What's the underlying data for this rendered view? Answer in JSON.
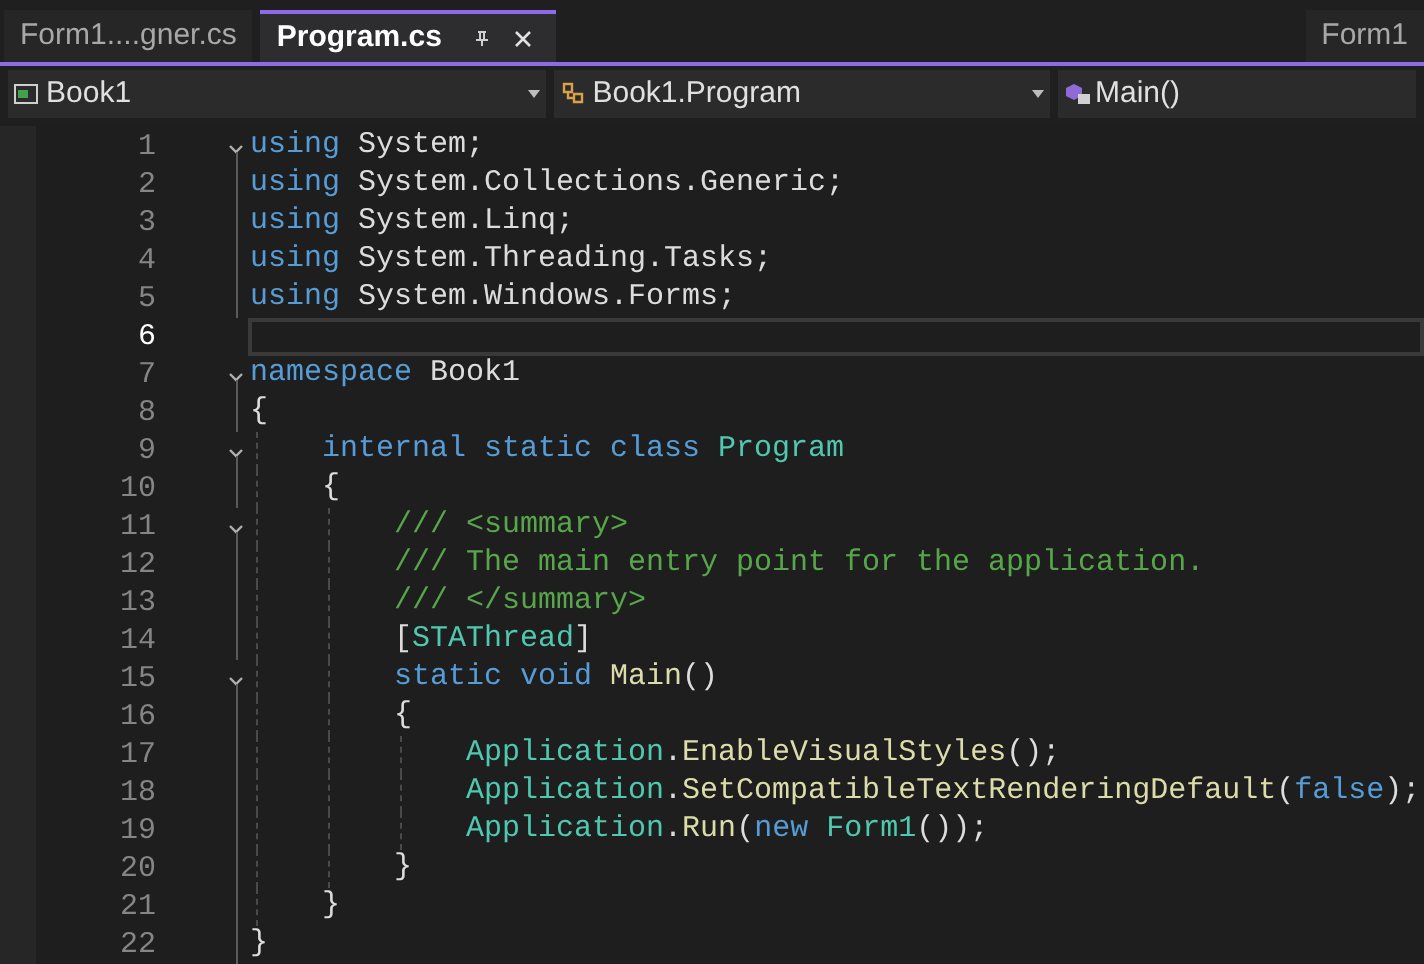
{
  "tabs": [
    {
      "label": "Form1....gner.cs",
      "selected": false,
      "pinned": false
    },
    {
      "label": "Program.cs",
      "selected": true,
      "pinned": true
    },
    {
      "label": "Form1",
      "selected": false,
      "pinned": false
    }
  ],
  "navigation": [
    {
      "label": "Book1",
      "kind": "project"
    },
    {
      "label": "Book1.Program",
      "kind": "class"
    },
    {
      "label": "Main()",
      "kind": "method"
    }
  ],
  "lines": [
    {
      "number": "1",
      "expanded": true,
      "current": false,
      "tokens": [
        {
          "text": "using ",
          "kind": "keyword"
        },
        {
          "text": "System;",
          "kind": "plain"
        }
      ]
    },
    {
      "number": "2",
      "current": false,
      "tokens": [
        {
          "text": "using ",
          "kind": "keyword"
        },
        {
          "text": "System.Collections.Generic;",
          "kind": "plain"
        }
      ]
    },
    {
      "number": "3",
      "current": false,
      "tokens": [
        {
          "text": "using ",
          "kind": "keyword"
        },
        {
          "text": "System.Linq;",
          "kind": "plain"
        }
      ]
    },
    {
      "number": "4",
      "current": false,
      "tokens": [
        {
          "text": "using ",
          "kind": "keyword"
        },
        {
          "text": "System.Threading.Tasks;",
          "kind": "plain"
        }
      ]
    },
    {
      "number": "5",
      "current": false,
      "tokens": [
        {
          "text": "using ",
          "kind": "keyword"
        },
        {
          "text": "System.Windows.Forms;",
          "kind": "plain"
        }
      ]
    },
    {
      "number": "6",
      "current": true
    },
    {
      "number": "7",
      "expanded": true,
      "current": false,
      "tokens": [
        {
          "text": "namespace ",
          "kind": "keyword"
        },
        {
          "text": "Book1",
          "kind": "plain"
        }
      ]
    },
    {
      "number": "8",
      "current": false,
      "tokens": [
        {
          "text": "{",
          "kind": "plain"
        }
      ],
      "children": [
        {
          "number": "9",
          "expanded": true,
          "current": false,
          "tokens": [
            {
              "text": "internal static class ",
              "kind": "keyword"
            },
            {
              "text": "Program",
              "kind": "type"
            }
          ]
        },
        {
          "number": "10",
          "current": false,
          "tokens": [
            {
              "text": "{",
              "kind": "plain"
            }
          ],
          "children": [
            {
              "number": "11",
              "expanded": true,
              "current": false,
              "tokens": [
                {
                  "text": "/// <summary>",
                  "kind": "comment"
                }
              ]
            },
            {
              "number": "12",
              "current": false,
              "tokens": [
                {
                  "text": "/// The main entry point for the application.",
                  "kind": "comment"
                }
              ]
            },
            {
              "number": "13",
              "current": false,
              "tokens": [
                {
                  "text": "/// </summary>",
                  "kind": "comment"
                }
              ]
            },
            {
              "number": "14",
              "current": false,
              "tokens": [
                {
                  "text": "[",
                  "kind": "plain"
                },
                {
                  "text": "STAThread",
                  "kind": "type"
                },
                {
                  "text": "]",
                  "kind": "plain"
                }
              ]
            },
            {
              "number": "15",
              "expanded": true,
              "current": false,
              "tokens": [
                {
                  "text": "static void ",
                  "kind": "keyword"
                },
                {
                  "text": "Main",
                  "kind": "method"
                },
                {
                  "text": "()",
                  "kind": "plain"
                }
              ]
            },
            {
              "number": "16",
              "current": false,
              "tokens": [
                {
                  "text": "{",
                  "kind": "plain"
                }
              ],
              "children": [
                {
                  "number": "17",
                  "current": false,
                  "tokens": [
                    {
                      "text": "Application",
                      "kind": "type"
                    },
                    {
                      "text": ".",
                      "kind": "plain"
                    },
                    {
                      "text": "EnableVisualStyles",
                      "kind": "method"
                    },
                    {
                      "text": "();",
                      "kind": "plain"
                    }
                  ]
                },
                {
                  "number": "18",
                  "current": false,
                  "tokens": [
                    {
                      "text": "Application",
                      "kind": "type"
                    },
                    {
                      "text": ".",
                      "kind": "plain"
                    },
                    {
                      "text": "SetCompatibleTextRenderingDefault",
                      "kind": "method"
                    },
                    {
                      "text": "(",
                      "kind": "plain"
                    },
                    {
                      "text": "false",
                      "kind": "keyword"
                    },
                    {
                      "text": ");",
                      "kind": "plain"
                    }
                  ]
                },
                {
                  "number": "19",
                  "current": false,
                  "tokens": [
                    {
                      "text": "Application",
                      "kind": "type"
                    },
                    {
                      "text": ".",
                      "kind": "plain"
                    },
                    {
                      "text": "Run",
                      "kind": "method"
                    },
                    {
                      "text": "(",
                      "kind": "plain"
                    },
                    {
                      "text": "new ",
                      "kind": "keyword"
                    },
                    {
                      "text": "Form1",
                      "kind": "type"
                    },
                    {
                      "text": "());",
                      "kind": "plain"
                    }
                  ]
                }
              ]
            },
            {
              "number": "20",
              "current": false,
              "tokens": [
                {
                  "text": "}",
                  "kind": "plain"
                }
              ]
            }
          ]
        },
        {
          "number": "21",
          "current": false,
          "tokens": [
            {
              "text": "}",
              "kind": "plain"
            }
          ]
        }
      ]
    },
    {
      "number": "22",
      "current": false,
      "tokens": [
        {
          "text": "}",
          "kind": "plain"
        }
      ]
    }
  ]
}
